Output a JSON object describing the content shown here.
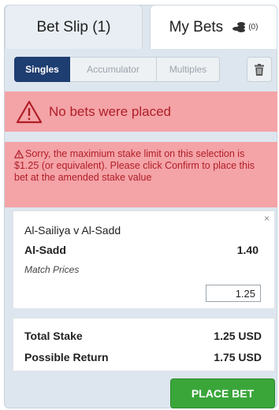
{
  "tabs": {
    "bet_slip": "Bet Slip (1)",
    "my_bets": "My Bets",
    "my_bets_count": "(0)"
  },
  "bet_types": [
    "Singles",
    "Accumulator",
    "Multiples"
  ],
  "active_bet_type": "Singles",
  "alerts": {
    "main": "No bets were placed",
    "stake_limit": "Sorry, the maximium stake limit on this selection is $1.25 (or equivalent). Please click Confirm to place this bet at the amended stake value"
  },
  "selection": {
    "close": "×",
    "event": "Al-Sailiya v Al-Sadd",
    "pick": "Al-Sadd",
    "odds": "1.40",
    "market": "Match Prices",
    "stake": "1.25"
  },
  "summary": {
    "total_stake_label": "Total Stake",
    "total_stake_value": "1.25 USD",
    "possible_return_label": "Possible Return",
    "possible_return_value": "1.75 USD"
  },
  "place_bet_label": "PLACE BET",
  "icons": {
    "trash": "trash-icon",
    "warning": "warning-triangle-icon",
    "coins": "coins-icon"
  },
  "colors": {
    "active_segment": "#1e3d71",
    "alert_bg": "#f4a3a7",
    "alert_text": "#b01e28",
    "place_bet": "#3aa63a"
  }
}
